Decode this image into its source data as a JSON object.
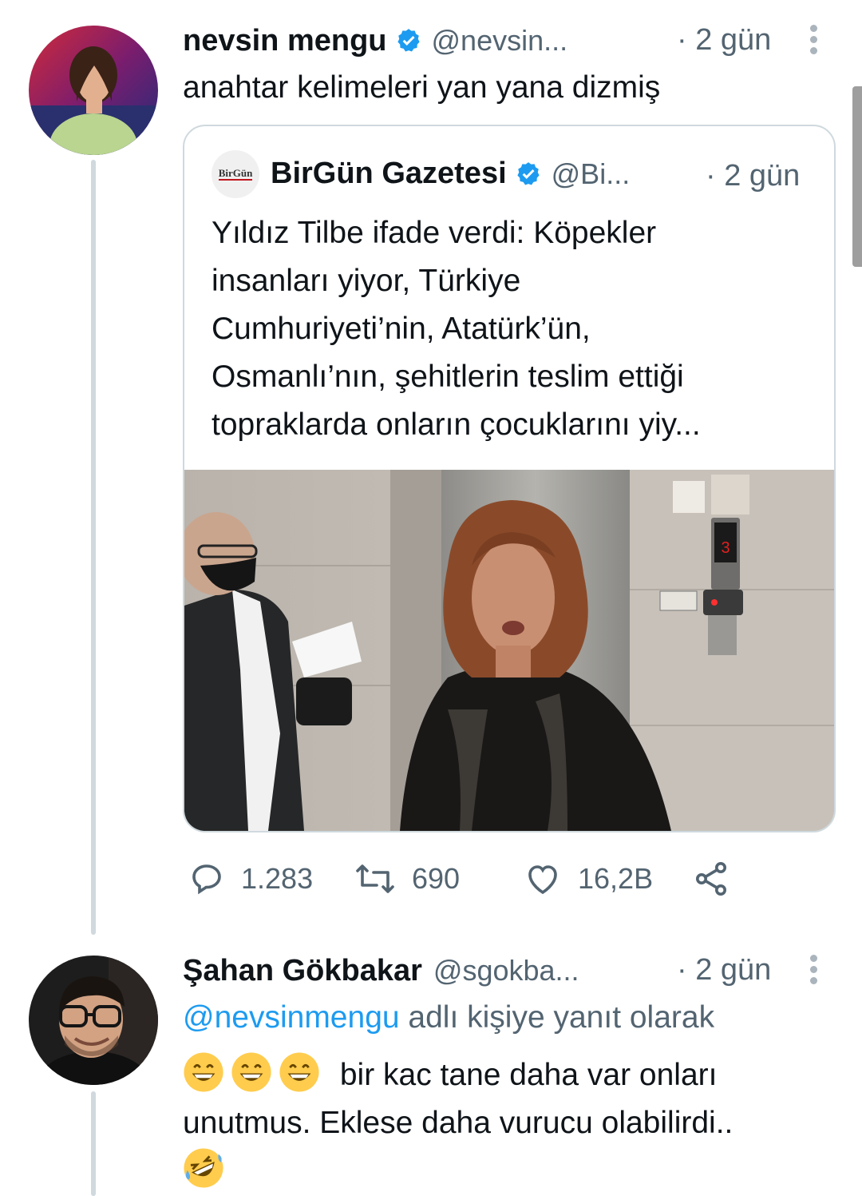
{
  "tweet1": {
    "author_name": "nevsin mengu",
    "handle": "@nevsin...",
    "time": "· 2 gün",
    "text": "anahtar kelimeleri yan yana dizmiş",
    "quote": {
      "logo_text": "BirGün",
      "author_name": "BirGün Gazetesi",
      "handle": "@Bi...",
      "time": "· 2 gün",
      "text_lines": [
        "Yıldız Tilbe ifade verdi:  Köpekler",
        "insanları yiyor, Türkiye",
        "Cumhuriyeti’nin, Atatürk’ün,",
        "Osmanlı’nın, şehitlerin teslim ettiği",
        "topraklarda onların çocuklarını yiy..."
      ],
      "elevator_floor": "3"
    },
    "actions": {
      "replies": "1.283",
      "retweets": "690",
      "likes": "16,2B"
    }
  },
  "tweet2": {
    "author_name": "Şahan Gökbakar",
    "handle": "@sgokba...",
    "time": "· 2 gün",
    "reply_mention": "@nevsinmengu",
    "reply_suffix": " adlı kişiye yanıt olarak",
    "text_line1": "bir kac tane daha var onları",
    "text_line2": "unutmus. Eklese daha vurucu olabilirdi.."
  },
  "colors": {
    "accent": "#1d9bf0",
    "secondary_text": "#536471",
    "border": "#cfd9de"
  },
  "icons": [
    "verified-badge-icon",
    "more-icon",
    "reply-icon",
    "retweet-icon",
    "like-icon",
    "share-icon",
    "grinning-emoji-icon",
    "rolling-laughing-emoji-icon"
  ]
}
